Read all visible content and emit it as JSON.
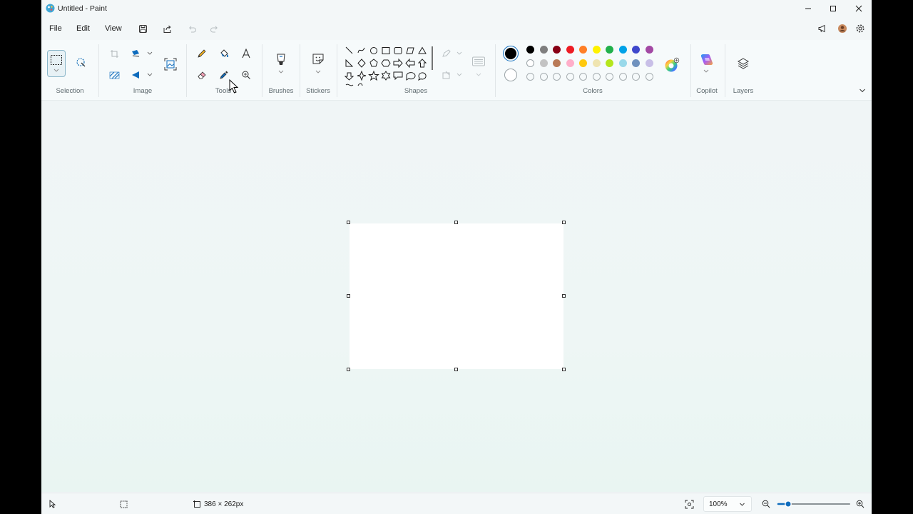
{
  "window": {
    "title": "Untitled - Paint"
  },
  "menu": {
    "file": "File",
    "edit": "Edit",
    "view": "View"
  },
  "ribbon": {
    "groups": {
      "selection": "Selection",
      "image": "Image",
      "tools": "Tools",
      "brushes": "Brushes",
      "stickers": "Stickers",
      "shapes": "Shapes",
      "colors": "Colors",
      "copilot": "Copilot",
      "layers": "Layers"
    }
  },
  "colors": {
    "primary": "#000000",
    "secondary": "#ffffff",
    "row1": [
      "#000000",
      "#7f7f7f",
      "#880015",
      "#ed1c24",
      "#ff7f27",
      "#fff200",
      "#22b14c",
      "#00a2e8",
      "#3f48cc",
      "#a349a4"
    ],
    "row2": [
      "#ffffff",
      "#c3c3c3",
      "#b97a57",
      "#ffaec9",
      "#ffc90e",
      "#efe4b0",
      "#b5e61d",
      "#99d9ea",
      "#7092be",
      "#c8bfe7"
    ]
  },
  "status": {
    "canvas_size": "386 × 262px",
    "zoom": "100%"
  }
}
